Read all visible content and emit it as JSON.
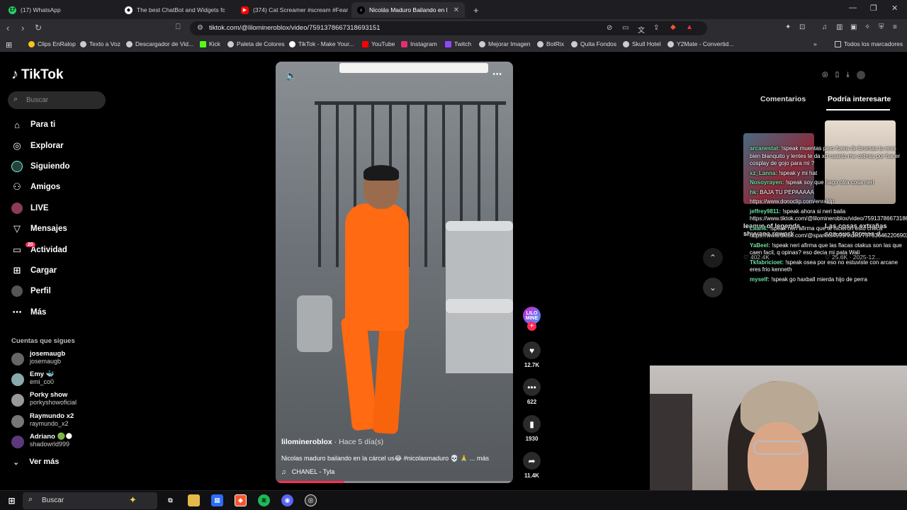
{
  "browser": {
    "tabs": [
      {
        "label": "(17) WhatsApp",
        "icon": "whatsapp-icon",
        "color": "#25d366"
      },
      {
        "label": "The best ChatBot and Widgets fc",
        "icon": "chatbot-icon",
        "color": "#ffffff"
      },
      {
        "label": "(374) Cat Screamer #scream #Fear #",
        "icon": "youtube-icon",
        "color": "#ff0000"
      },
      {
        "label": "Nicolás Maduro Bailando en l",
        "icon": "tiktok-icon",
        "color": "#ffffff"
      }
    ],
    "url": "tiktok.com/@lilomineroblox/video/7591378667318693151",
    "bookmarks": [
      {
        "label": "Clips EnRalop",
        "color": "#f5c518"
      },
      {
        "label": "Texto a Voz",
        "color": "#cccccc"
      },
      {
        "label": "Descargador de Vid...",
        "color": "#cccccc"
      },
      {
        "label": "Kick",
        "color": "#53fc18"
      },
      {
        "label": "Paleta de Colores",
        "color": "#cccccc"
      },
      {
        "label": "TikTok - Make Your...",
        "color": "#ffffff"
      },
      {
        "label": "YouTube",
        "color": "#ff0000"
      },
      {
        "label": "Instagram",
        "color": "#e1306c"
      },
      {
        "label": "Twitch",
        "color": "#9146ff"
      },
      {
        "label": "Mejorar Imagen",
        "color": "#cccccc"
      },
      {
        "label": "BotRix",
        "color": "#cccccc"
      },
      {
        "label": "Quita Fondos",
        "color": "#cccccc"
      },
      {
        "label": "Skull Hotel",
        "color": "#cccccc"
      },
      {
        "label": "Y2Mate - Convertid...",
        "color": "#cccccc"
      }
    ],
    "all_bookmarks": "Todos los marcadores"
  },
  "sidebar": {
    "logo": "TikTok",
    "search_placeholder": "Buscar",
    "nav": [
      {
        "label": "Para ti",
        "icon": "home-icon",
        "glyph": "⌂"
      },
      {
        "label": "Explorar",
        "icon": "compass-icon",
        "glyph": "◎"
      },
      {
        "label": "Siguiendo",
        "icon": "following-avatar-icon",
        "glyph": "●"
      },
      {
        "label": "Amigos",
        "icon": "friends-icon",
        "glyph": "👥"
      },
      {
        "label": "LIVE",
        "icon": "live-icon",
        "glyph": "●"
      },
      {
        "label": "Mensajes",
        "icon": "messages-icon",
        "glyph": "▽"
      },
      {
        "label": "Actividad",
        "icon": "activity-icon",
        "glyph": "▭"
      },
      {
        "label": "Cargar",
        "icon": "upload-icon",
        "glyph": "⊞"
      },
      {
        "label": "Perfil",
        "icon": "profile-avatar-icon",
        "glyph": "●"
      },
      {
        "label": "Más",
        "icon": "more-icon",
        "glyph": "⋯"
      }
    ],
    "activity_badge": "20",
    "following_title": "Cuentas que sigues",
    "accounts": [
      {
        "name": "josemaugb",
        "user": "josemaugb"
      },
      {
        "name": "Emy 🐳",
        "user": "emi_co0"
      },
      {
        "name": "Porky show",
        "user": "porkyshowoficial"
      },
      {
        "name": "Raymundo x2",
        "user": "raymundo_x2"
      },
      {
        "name": "Adriano 🟢🌑",
        "user": "shadowrld999"
      }
    ],
    "see_more": "Ver más"
  },
  "video": {
    "author": "lilomineroblox",
    "age": " · Hace 5 día(s)",
    "caption": "Nicolas maduro bailando en la cárcel us😂 #nicolasmaduro 💀 🙏 ... más",
    "music": "CHANEL - Tyla",
    "progress": 0.29
  },
  "actions": {
    "likes": "12.7K",
    "comments": "622",
    "saves": "1930",
    "shares": "11.4K",
    "creator_badge": "LILO MINE"
  },
  "right_panel": {
    "tab_comments": "Comentarios",
    "tab_recommended": "Podría interesarte",
    "recommended": [
      {
        "title": "league of legends shyvana rework",
        "meta": "♡ 402.4K",
        "thumb_color": "#5a6a7a"
      },
      {
        "title": "Las cosas extrañas son sus formas d...",
        "meta": "♡ 25.6K · 2025-12...",
        "thumb_color": "#d8cfc6"
      }
    ]
  },
  "chat": [
    {
      "user": "arcanestat:",
      "text": "!speak muentas pero fuera de bromas tu eres bien blanquito y lentes te da xd cuanto me cobras por hacer cosplay de gojo para mi ?"
    },
    {
      "user": "xz_Lanna:",
      "text": "!speak y mi hat"
    },
    {
      "user": "Nosoyrayen:",
      "text": "!speak soy que hago otra cosa neri"
    },
    {
      "user": "hk:",
      "text": "BAJA TU PEPAAAAA"
    },
    {
      "user": "",
      "text": "https://www.donoclip.com/enraldp"
    },
    {
      "user": "jeffrey9811:",
      "text": "!speak ahora si neri baila https://www.tiktok.com/@lilomineroblox/video/7591378667318693151"
    },
    {
      "user": "Lilan4:",
      "text": "!speak neri afirma que te hicieron esto checa https://www.tiktok.com/@sparkxs4999/video/7576364622069026070"
    },
    {
      "user": "YaBeel:",
      "text": "!speak neri afirma que las flacas otakus son las que caen facil, q opinas? eso decia mi pata Wali"
    },
    {
      "user": "Tkfabricioet:",
      "text": "!speak osea por eso no estuviste con arcane eres frio kenneth"
    },
    {
      "user": "myself:",
      "text": "!speak go haxball mierda hijo de perra"
    }
  ],
  "taskbar": {
    "search_placeholder": "Buscar"
  }
}
